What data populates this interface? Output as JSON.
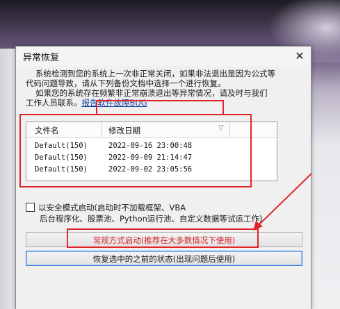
{
  "dialog": {
    "title": "异常恢复",
    "close_symbol": "✕",
    "message_line1": "系统检测到您的系统上一次非正常关闭，如果非法退出是因为公式等",
    "message_line2": "代码问题导致，请从下列备份文档中选择一个进行恢复。",
    "message_line3": "如果您的系统存在频繁非正常崩溃退出等异常情况，请及时与我们",
    "message_line4_prefix": "工作人员联系。",
    "bug_link": "报告软件故障BUG"
  },
  "file_list": {
    "headers": [
      "文件名",
      "修改日期"
    ],
    "sort_symbol": "▽",
    "rows": [
      {
        "name": "Default(150)",
        "date": "2022-09-16 23:00:48"
      },
      {
        "name": "Default(150)",
        "date": "2022-09-09 21:14:47"
      },
      {
        "name": "Default(150)",
        "date": "2022-09-02 23:05:56"
      }
    ]
  },
  "safe_mode": {
    "label_line1": "以安全模式启动(启动时不加载框架、VBA",
    "label_line2": "后台程序化、股票池、Python运行池、自定义数据等试运工作)"
  },
  "buttons": {
    "normal_start": "常规方式启动(推荐在大多数情况下使用)",
    "restore": "恢复选中的之前的状态(出现问题后使用)"
  },
  "colors": {
    "annotation_red": "#e0242a",
    "link_blue": "#1040a0",
    "focus_blue": "#3c7fd8"
  }
}
